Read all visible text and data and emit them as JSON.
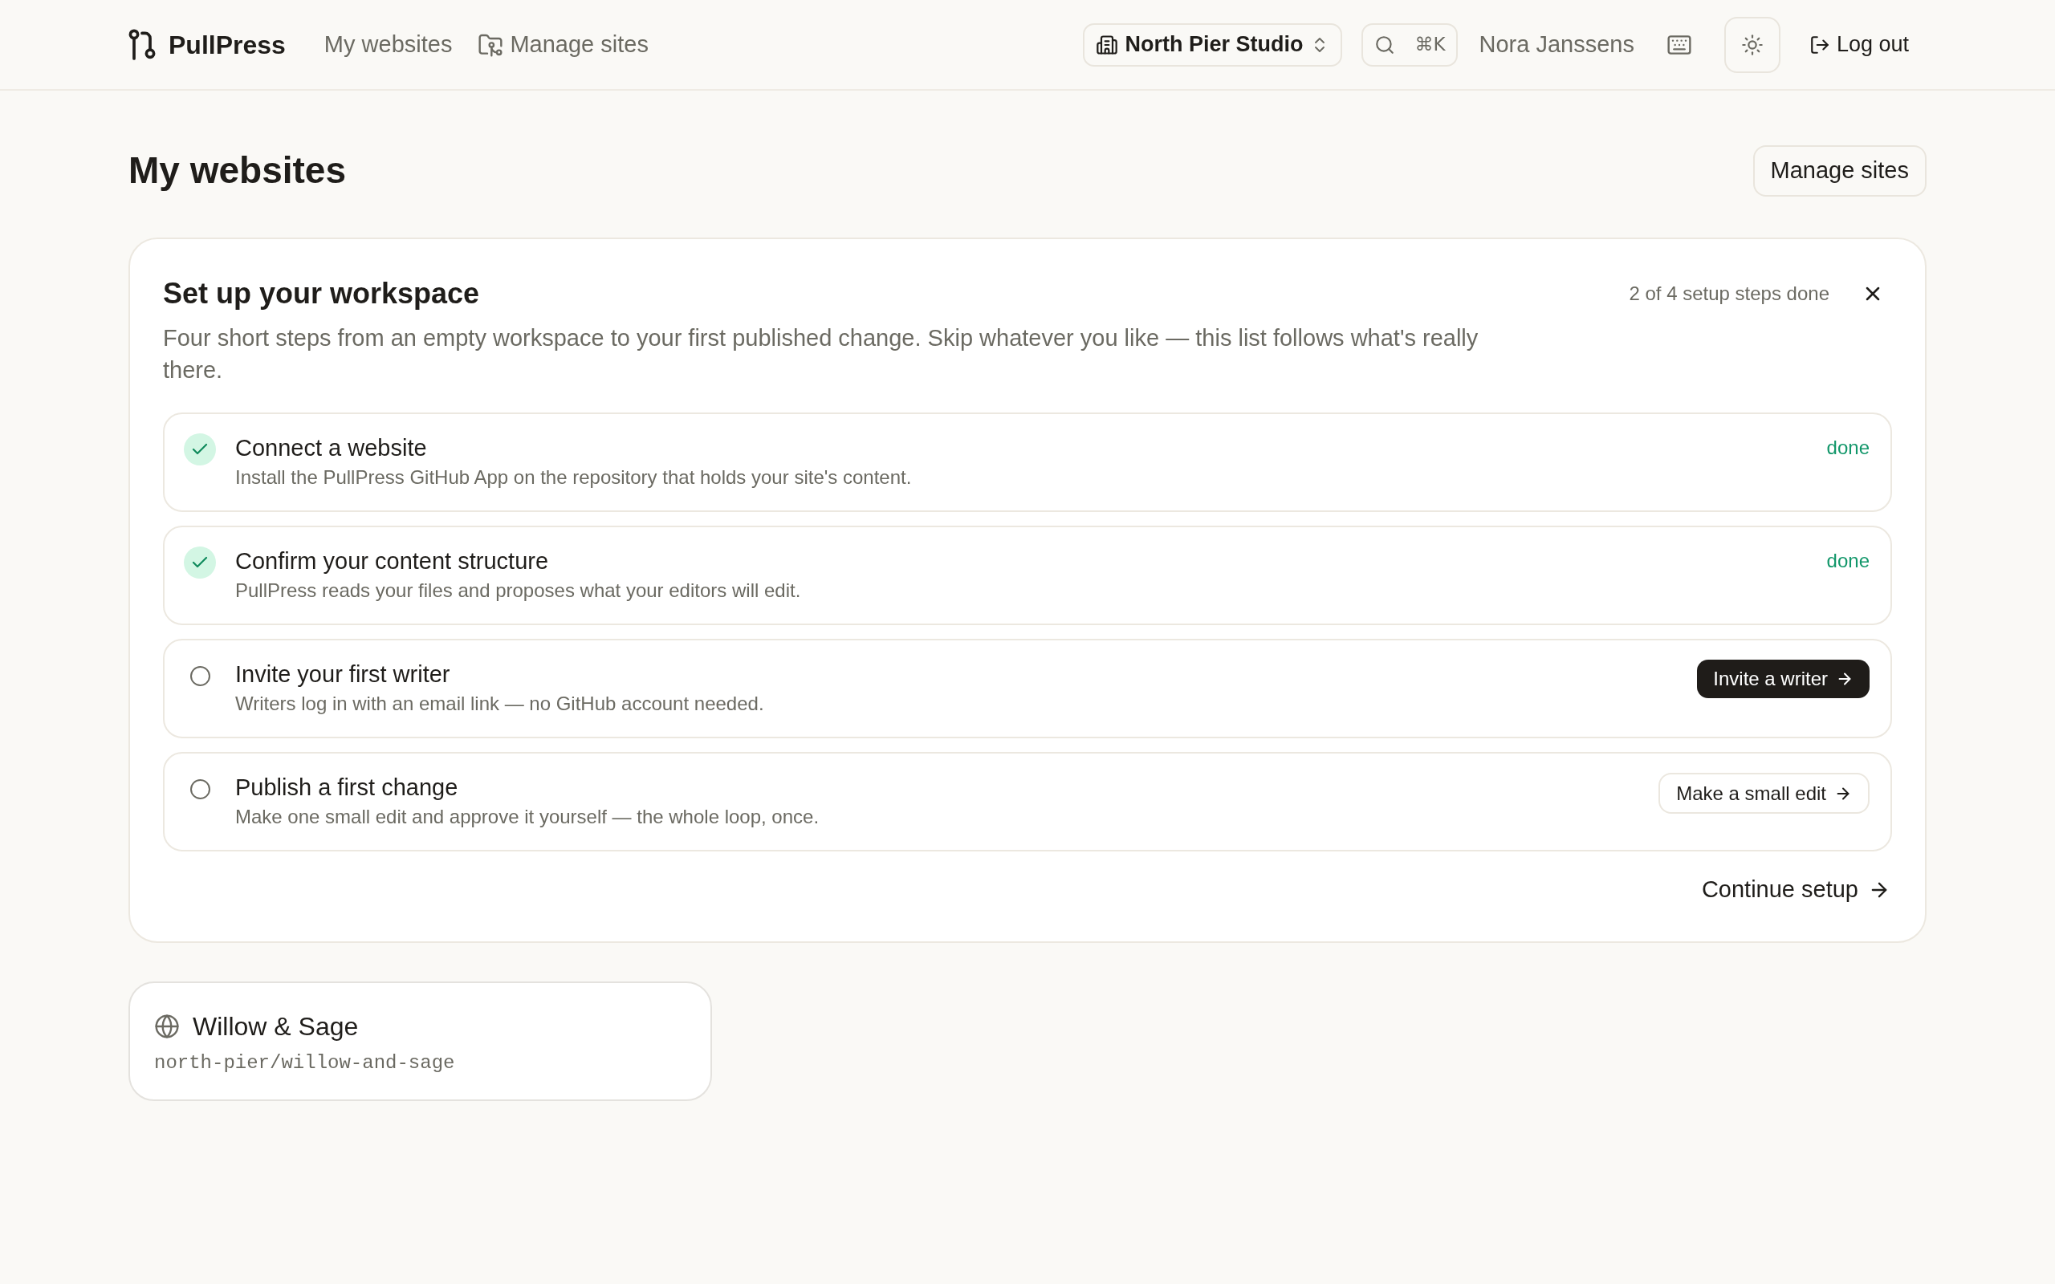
{
  "header": {
    "brand": "PullPress",
    "nav": [
      {
        "label": "My websites",
        "kind": "link"
      },
      {
        "label": "Manage sites",
        "kind": "icon_link"
      }
    ],
    "workspace": "North Pier Studio",
    "search_shortcut": "⌘K",
    "user": "Nora Janssens",
    "logout": "Log out"
  },
  "page": {
    "title": "My websites",
    "action": "Manage sites"
  },
  "setup": {
    "title": "Set up your workspace",
    "description": "Four short steps from an empty workspace to your first published change. Skip whatever you like — this list follows what's really there.",
    "progress": "2 of 4 setup steps done",
    "steps": [
      {
        "title": "Connect a website",
        "description": "Install the PullPress GitHub App on the repository that holds your site's content.",
        "done": true,
        "status_label": "done"
      },
      {
        "title": "Confirm your content structure",
        "description": "PullPress reads your files and proposes what your editors will edit.",
        "done": true,
        "status_label": "done"
      },
      {
        "title": "Invite your first writer",
        "description": "Writers log in with an email link — no GitHub account needed.",
        "done": false,
        "action": {
          "label": "Invite a writer",
          "kind": "primary"
        }
      },
      {
        "title": "Publish a first change",
        "description": "Make one small edit and approve it yourself — the whole loop, once.",
        "done": false,
        "action": {
          "label": "Make a small edit",
          "kind": "secondary"
        }
      }
    ],
    "continue": "Continue setup"
  },
  "websites": [
    {
      "name": "Willow & Sage",
      "repo": "north-pier/willow-and-sage"
    }
  ]
}
